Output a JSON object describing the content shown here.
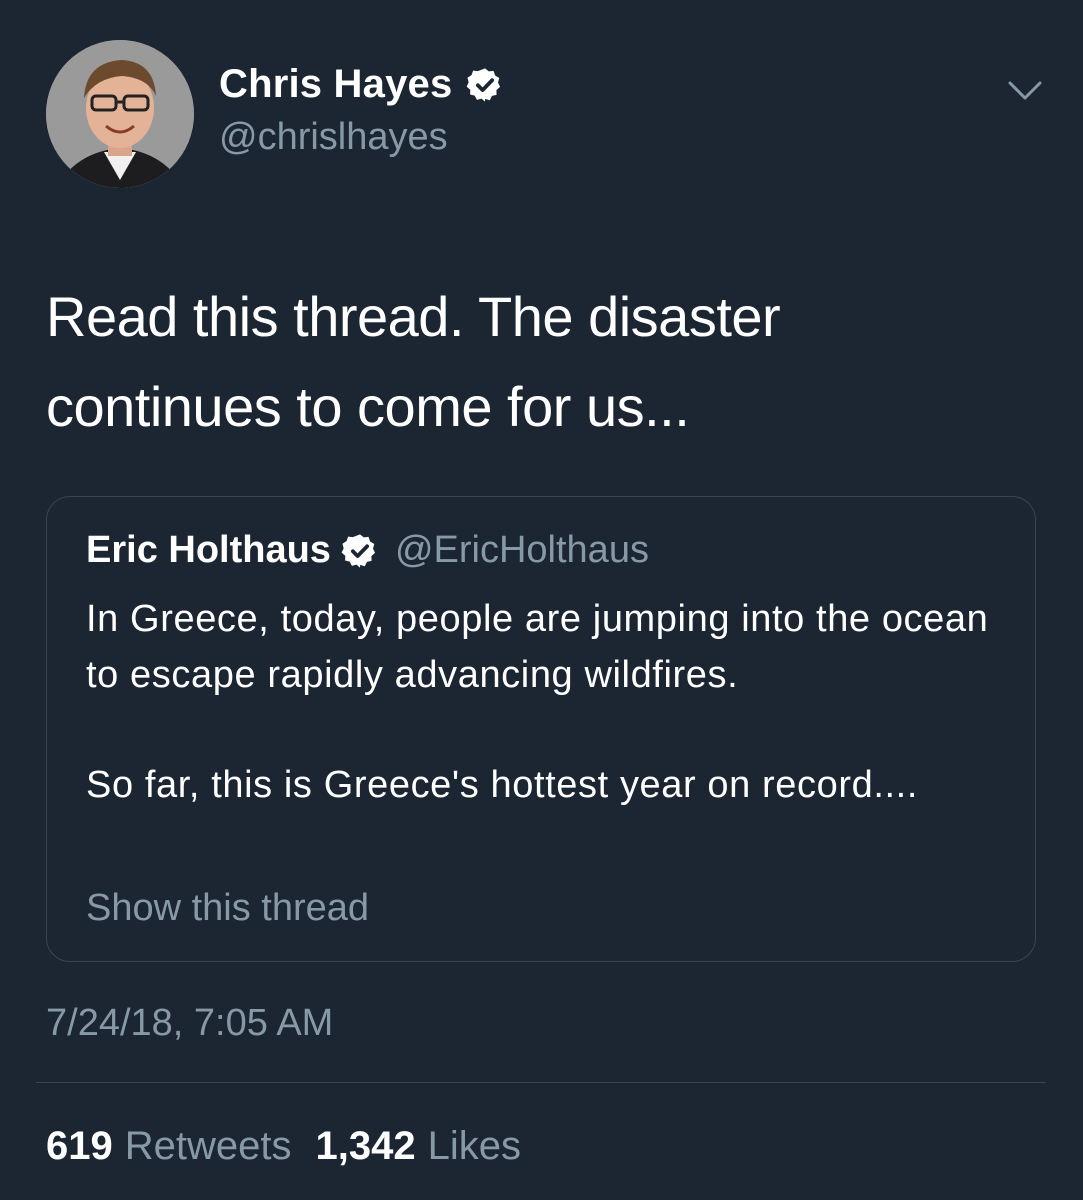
{
  "tweet": {
    "author": {
      "name": "Chris Hayes",
      "handle": "@chrislhayes",
      "verified": true
    },
    "text": "Read this thread. The disaster\ncontinues to come for us...",
    "quoted": {
      "name": "Eric Holthaus",
      "handle": "@EricHolthaus",
      "verified": true,
      "text_line1": "In Greece, today, people are jumping into the ocean to escape rapidly advancing wildfires.",
      "text_line2": "So far, this is Greece's hottest year on record....",
      "show_thread_label": "Show this thread"
    },
    "timestamp": "7/24/18, 7:05 AM",
    "stats": {
      "retweets_count": "619",
      "retweets_label": "Retweets",
      "likes_count": "1,342",
      "likes_label": "Likes"
    }
  },
  "colors": {
    "background": "#1c2532",
    "text_primary": "#ffffff",
    "text_secondary": "#8899a6",
    "border": "#3a4450"
  },
  "icons": {
    "verified": "verified-badge-icon",
    "caret": "chevron-down-icon"
  }
}
